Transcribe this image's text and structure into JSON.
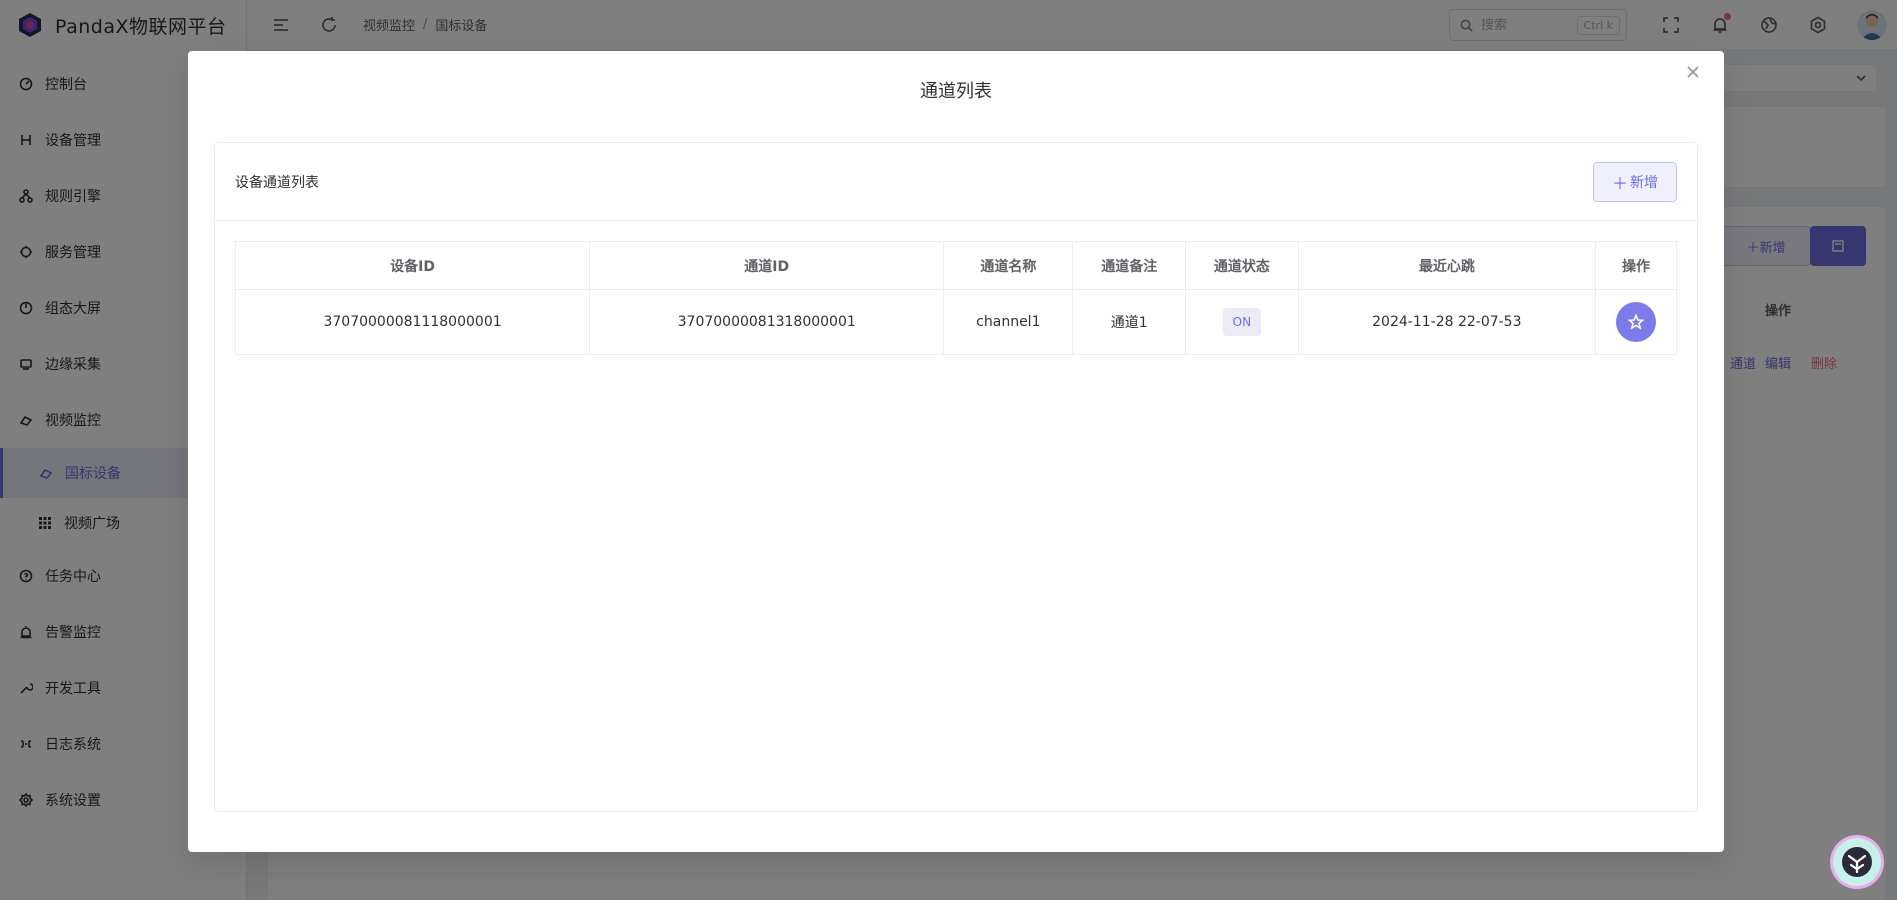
{
  "app": {
    "title": "PandaX物联网平台"
  },
  "sidebar": {
    "items": [
      {
        "label": "控制台",
        "icon": "dashboard-icon"
      },
      {
        "label": "设备管理",
        "icon": "device-icon"
      },
      {
        "label": "规则引擎",
        "icon": "rule-icon"
      },
      {
        "label": "服务管理",
        "icon": "service-icon"
      },
      {
        "label": "组态大屏",
        "icon": "screen-icon"
      },
      {
        "label": "边缘采集",
        "icon": "edge-icon"
      },
      {
        "label": "视频监控",
        "icon": "video-icon"
      },
      {
        "label": "国标设备",
        "icon": "gb-device-icon",
        "active": true,
        "sub": true
      },
      {
        "label": "视频广场",
        "icon": "grid-icon",
        "sub": true
      },
      {
        "label": "任务中心",
        "icon": "task-icon"
      },
      {
        "label": "告警监控",
        "icon": "alarm-icon"
      },
      {
        "label": "开发工具",
        "icon": "tool-icon"
      },
      {
        "label": "日志系统",
        "icon": "log-icon"
      },
      {
        "label": "系统设置",
        "icon": "settings-icon"
      }
    ]
  },
  "header": {
    "breadcrumb": [
      "视频监控",
      "国标设备"
    ],
    "breadcrumb_sep": "/",
    "search_placeholder": "搜索",
    "search_shortcut": "Ctrl k"
  },
  "background_page": {
    "add_label": "新增",
    "action_header": "操作",
    "links": [
      "通道",
      "编辑",
      "删除"
    ]
  },
  "dialog": {
    "title": "通道列表",
    "panel_title": "设备通道列表",
    "add_label": "新增",
    "table": {
      "headers": [
        "设备ID",
        "通道ID",
        "通道名称",
        "通道备注",
        "通道状态",
        "最近心跳",
        "操作"
      ],
      "rows": [
        {
          "device_id": "37070000081118000001",
          "channel_id": "37070000081318000001",
          "channel_name": "channel1",
          "channel_remark": "通道1",
          "channel_status": "ON",
          "last_heartbeat": "2024-11-28 22-07-53"
        }
      ]
    }
  },
  "colors": {
    "primary": "#6c6ce0",
    "primary_light": "#ebebf8",
    "danger": "#f56c6c",
    "overlay": "rgba(0,0,0,0.5)"
  }
}
